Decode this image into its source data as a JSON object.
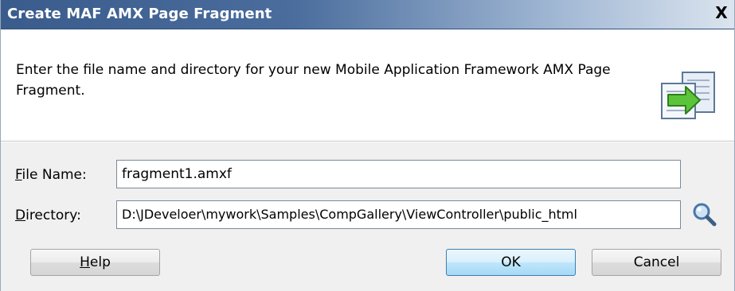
{
  "dialog": {
    "title": "Create MAF AMX Page Fragment",
    "close_label": "X"
  },
  "header": {
    "description": "Enter the file name and directory for your new Mobile Application Framework AMX Page Fragment.",
    "icon": "wizard-new-file-arrow-icon"
  },
  "form": {
    "file_name": {
      "mnemonic": "F",
      "label_rest": "ile Name:",
      "value": "fragment1.amxf"
    },
    "directory": {
      "mnemonic": "D",
      "label_rest": "irectory:",
      "value": "D:\\JDeveloer\\mywork\\Samples\\CompGallery\\ViewController\\public_html",
      "browse_icon": "magnifier-icon"
    }
  },
  "buttons": {
    "help": {
      "mnemonic": "H",
      "rest": "elp"
    },
    "ok": "OK",
    "cancel": "Cancel"
  },
  "colors": {
    "titlebar_start": "#3a5c8c",
    "titlebar_end": "#dbe4ef",
    "dialog_bg": "#f0f0f0",
    "ok_border": "#3c7fb1"
  }
}
